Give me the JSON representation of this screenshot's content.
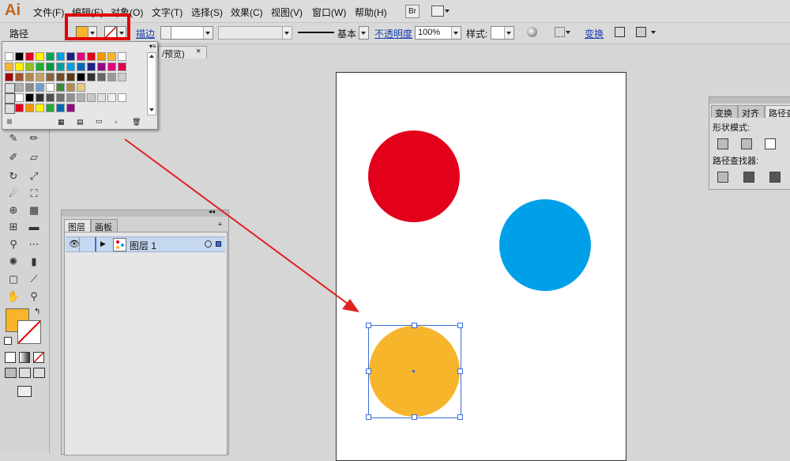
{
  "app": {
    "logo": "Ai"
  },
  "menu": [
    "文件(F)",
    "编辑(E)",
    "对象(O)",
    "文字(T)",
    "选择(S)",
    "效果(C)",
    "视图(V)",
    "窗口(W)",
    "帮助(H)"
  ],
  "menubar_buttons": {
    "bridge": "Br"
  },
  "control_bar": {
    "object_type": "路径",
    "stroke_link": "描边",
    "stroke_style": "基本",
    "opacity_link": "不透明度",
    "opacity_value": "100%",
    "style_label": "样式:",
    "transform_link": "变换"
  },
  "document_tab": {
    "label": "/预览)"
  },
  "layers_panel": {
    "tabs": [
      "图层",
      "画板"
    ],
    "layer_name": "图层 1"
  },
  "pathfinder_panel": {
    "tabs": [
      "变换",
      "对齐",
      "路径查"
    ],
    "shape_modes_label": "形状模式:",
    "pathfinders_label": "路径查找器:"
  },
  "colors": {
    "fill": "#f7b52c",
    "red_circle": "#e2001a",
    "blue_circle": "#00a0e9",
    "orange_circle": "#f7b52c",
    "highlight": "#e00000",
    "arrow": "#e0221c",
    "selection": "#3b6fd6"
  },
  "swatch_rows": [
    [
      "#ffffff",
      "#000000",
      "#e2001a",
      "#fff100",
      "#00a650",
      "#00a0e9",
      "#1d2088",
      "#e4007f",
      "#e60012",
      "#f39800",
      "#f7b52c",
      "#ffffff"
    ],
    [
      "#f7b52c",
      "#fff100",
      "#8fc31f",
      "#22ac38",
      "#009944",
      "#00a0a0",
      "#00a0e9",
      "#0068b7",
      "#1d2088",
      "#920783",
      "#e4007f",
      "#e5004f"
    ],
    [
      "#a40000",
      "#a0522d",
      "#b28850",
      "#c9a063",
      "#8c6239",
      "#754c24",
      "#603813",
      "#000000",
      "#333333",
      "#666666",
      "#999999",
      "#cccccc"
    ],
    [
      "#b0b0b0",
      "#8a8a8a",
      "#6fa0d0",
      "#ffffff",
      "#3c8c3c",
      "#b88a4a",
      "#e8c87a"
    ],
    [
      "#ffffff",
      "#000000",
      "#303030",
      "#505050",
      "#707070",
      "#909090",
      "#b0b0b0",
      "#c8c8c8",
      "#e0e0e0",
      "#f0f0f0",
      "#ffffff"
    ],
    [
      "#e2001a",
      "#f39800",
      "#fff100",
      "#22ac38",
      "#0068b7",
      "#920783"
    ]
  ]
}
